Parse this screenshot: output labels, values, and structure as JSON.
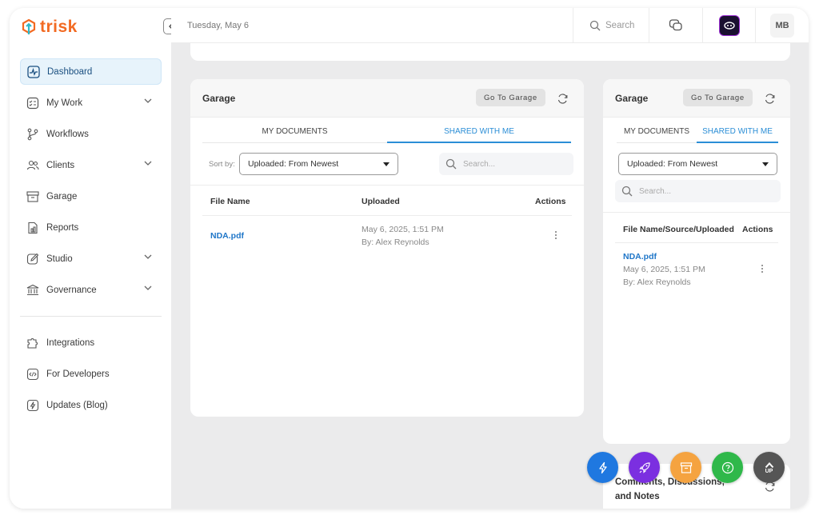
{
  "app": {
    "logo_text": "trisk",
    "brand_color": "#f26a22",
    "accent_color": "#2b8ed6"
  },
  "topbar": {
    "date": "Tuesday, May 6",
    "search_placeholder": "Search",
    "avatar_initials": "MB"
  },
  "sidebar": {
    "items": [
      {
        "label": "Dashboard",
        "icon": "pulse-icon",
        "active": true
      },
      {
        "label": "My Work",
        "icon": "checklist-icon",
        "expandable": true
      },
      {
        "label": "Workflows",
        "icon": "workflow-icon"
      },
      {
        "label": "Clients",
        "icon": "users-icon",
        "expandable": true
      },
      {
        "label": "Garage",
        "icon": "archive-icon"
      },
      {
        "label": "Reports",
        "icon": "report-icon"
      },
      {
        "label": "Studio",
        "icon": "edit-icon",
        "expandable": true
      },
      {
        "label": "Governance",
        "icon": "institution-icon",
        "expandable": true
      }
    ],
    "bottom_items": [
      {
        "label": "Integrations",
        "icon": "puzzle-icon"
      },
      {
        "label": "For Developers",
        "icon": "code-icon"
      },
      {
        "label": "Updates (Blog)",
        "icon": "lightning-icon"
      }
    ]
  },
  "garage_left": {
    "title": "Garage",
    "goto_label": "Go To Garage",
    "tabs": [
      "MY DOCUMENTS",
      "SHARED WITH ME"
    ],
    "active_tab": 1,
    "sort_label": "Sort by:",
    "sort_value": "Uploaded: From Newest",
    "search_placeholder": "Search...",
    "columns": [
      "File Name",
      "Uploaded",
      "Actions"
    ],
    "rows": [
      {
        "file": "NDA.pdf",
        "date": "May 6, 2025, 1:51 PM",
        "by": "By: Alex Reynolds"
      }
    ]
  },
  "garage_right": {
    "title": "Garage",
    "goto_label": "Go To Garage",
    "tabs": [
      "MY DOCUMENTS",
      "SHARED WITH ME"
    ],
    "active_tab": 1,
    "sort_value": "Uploaded: From Newest",
    "search_placeholder": "Search...",
    "columns": [
      "File Name/Source/Uploaded",
      "Actions"
    ],
    "rows": [
      {
        "file": "NDA.pdf",
        "date": "May 6, 2025, 1:51 PM",
        "by": "By: Alex Reynolds"
      }
    ]
  },
  "comments": {
    "title": "Comments, Discussions, and Notes"
  },
  "fabs": [
    {
      "name": "quick-action",
      "color": "#1f78e0",
      "icon": "lightning-icon"
    },
    {
      "name": "launch",
      "color": "#7b2fe0",
      "icon": "rocket-icon"
    },
    {
      "name": "archive",
      "color": "#f5a340",
      "icon": "archive-icon"
    },
    {
      "name": "help",
      "color": "#2fb84a",
      "icon": "help-icon"
    },
    {
      "name": "scroll-up",
      "color": "#555555",
      "icon": "arrow-up-icon",
      "label": "UP"
    }
  ]
}
